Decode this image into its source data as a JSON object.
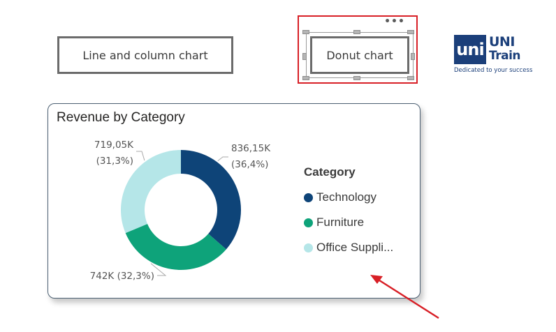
{
  "toolbar": {
    "line_column_button": "Line and column chart",
    "donut_button": "Donut chart",
    "more_options": "•••"
  },
  "logo": {
    "mark": "uni",
    "line1": "UNI",
    "line2": "Train",
    "tagline": "Dedicated to your success"
  },
  "colors": {
    "selection_border": "#d81f26",
    "annotation_arrow": "#d81f26",
    "technology": "#0e4478",
    "furniture": "#0ea37a",
    "office_supplies": "#b5e6e8"
  },
  "chart_data": {
    "type": "pie",
    "variant": "donut",
    "title": "Revenue by Category",
    "legend_title": "Category",
    "legend_position": "right",
    "categories": [
      "Technology",
      "Furniture",
      "Office Supplies"
    ],
    "values": [
      836150,
      742000,
      719050
    ],
    "percentages": [
      36.4,
      32.3,
      31.3
    ],
    "colors": [
      "#0e4478",
      "#0ea37a",
      "#b5e6e8"
    ],
    "data_labels": [
      {
        "value": "836,15K",
        "percent": "(36,4%)"
      },
      {
        "value": "742K (32,3%)",
        "percent": ""
      },
      {
        "value": "719,05K",
        "percent": "(31,3%)"
      }
    ],
    "legend_labels": [
      "Technology",
      "Furniture",
      "Office Suppli..."
    ]
  }
}
